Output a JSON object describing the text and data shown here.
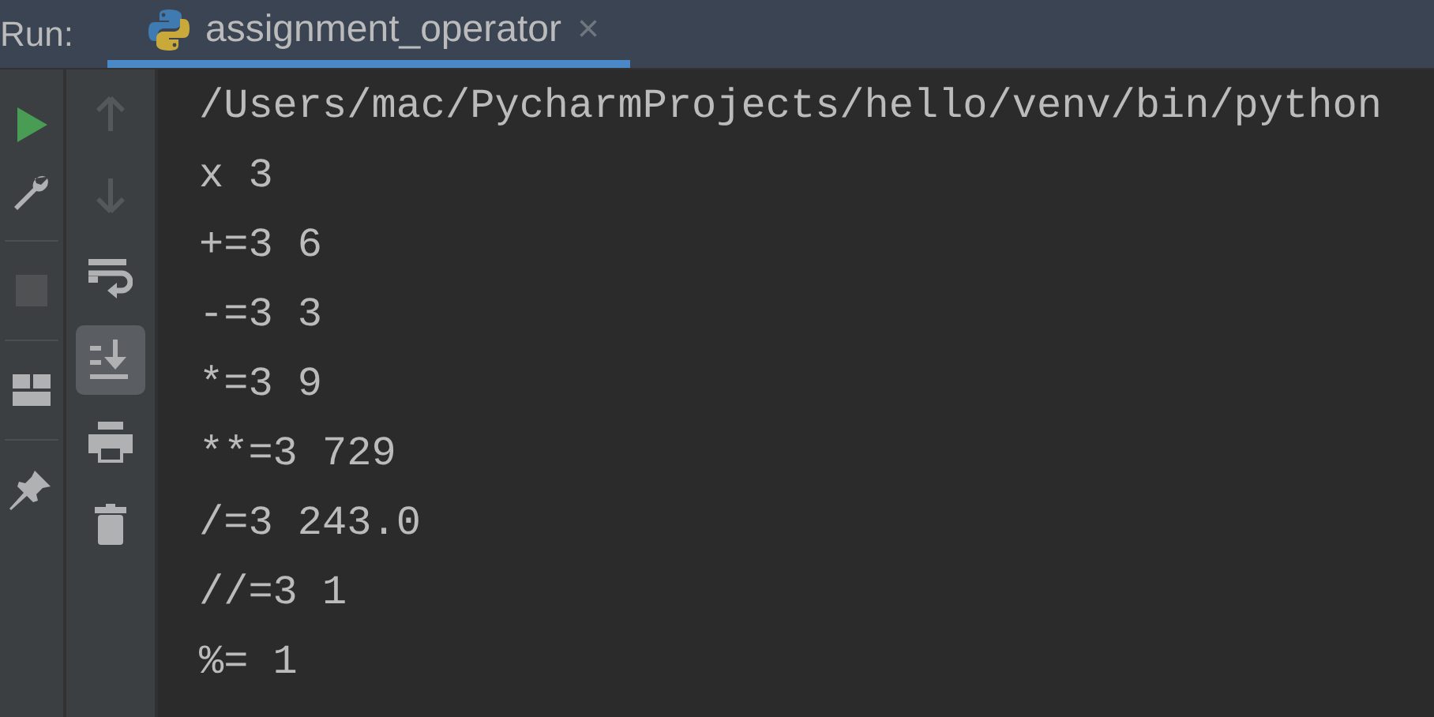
{
  "run_label": "Run:",
  "tabs": [
    {
      "label": "assignment_operator",
      "close": "×",
      "selected": true
    }
  ],
  "left_toolbar": [
    {
      "kind": "run",
      "enabled": true
    },
    {
      "kind": "settings",
      "enabled": true
    },
    {
      "kind": "divider"
    },
    {
      "kind": "stop",
      "enabled": false
    },
    {
      "kind": "divider"
    },
    {
      "kind": "layout",
      "enabled": true
    },
    {
      "kind": "divider"
    },
    {
      "kind": "pin",
      "enabled": true
    }
  ],
  "console_toolbar": [
    {
      "kind": "up",
      "enabled": false,
      "selected": false
    },
    {
      "kind": "down",
      "enabled": false,
      "selected": false
    },
    {
      "kind": "wrap",
      "enabled": true,
      "selected": false
    },
    {
      "kind": "scroll-end",
      "enabled": true,
      "selected": true
    },
    {
      "kind": "print",
      "enabled": true,
      "selected": false
    },
    {
      "kind": "trash",
      "enabled": true,
      "selected": false
    }
  ],
  "console_lines": [
    "/Users/mac/PycharmProjects/hello/venv/bin/python",
    "x 3",
    "+=3 6",
    "-=3 3",
    "*=3 9",
    "**=3 729",
    "/=3 243.0",
    "//=3 1",
    "%= 1"
  ]
}
